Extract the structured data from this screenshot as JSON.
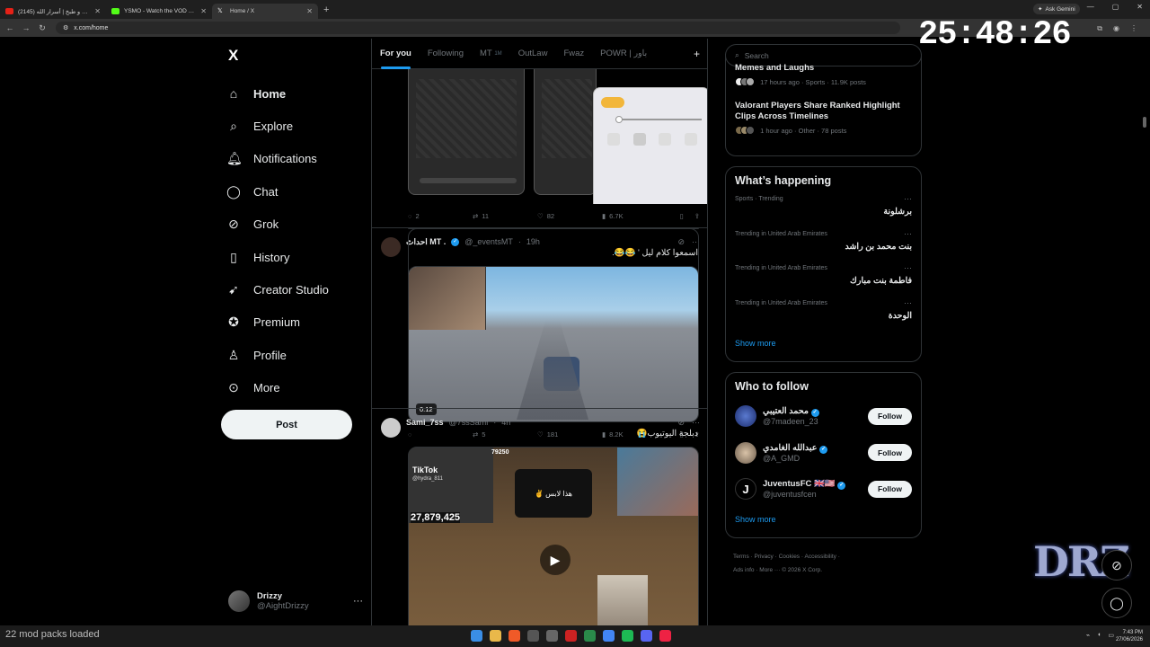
{
  "browser": {
    "tabs": [
      {
        "label": "سوالف و طبخ | أسرار الله (2145)",
        "icon_color": "#e62117",
        "icon": "youtube-icon"
      },
      {
        "label": "YSMO - Watch the VOD on Kick",
        "icon_color": "#53fc18",
        "icon": "kick-icon"
      },
      {
        "label": "Home / X",
        "icon_color": "#ffffff",
        "icon": "x-icon"
      }
    ],
    "new_tab": "+",
    "gemini": "Ask Gemini",
    "url": "x.com/home"
  },
  "overlay": {
    "clock": "25:48:26",
    "logo": "DRZ",
    "mod_packs": "22 mod packs loaded"
  },
  "sidebar": {
    "logo": "X",
    "items": [
      {
        "label": "Home",
        "icon": "home-icon",
        "glyph": "⌂"
      },
      {
        "label": "Explore",
        "icon": "search-icon",
        "glyph": "⌕"
      },
      {
        "label": "Notifications",
        "icon": "bell-icon",
        "glyph": "🔔︎"
      },
      {
        "label": "Chat",
        "icon": "chat-icon",
        "glyph": "◯"
      },
      {
        "label": "Grok",
        "icon": "grok-icon",
        "glyph": "⊘"
      },
      {
        "label": "History",
        "icon": "bookmark-icon",
        "glyph": "▯"
      },
      {
        "label": "Creator Studio",
        "icon": "rocket-icon",
        "glyph": "➹"
      },
      {
        "label": "Premium",
        "icon": "premium-icon",
        "glyph": "✪"
      },
      {
        "label": "Profile",
        "icon": "profile-icon",
        "glyph": "♙"
      },
      {
        "label": "More",
        "icon": "more-icon",
        "glyph": "⊙"
      }
    ],
    "post_button": "Post",
    "account": {
      "name": "Drizzy",
      "handle": "@AightDrizzy",
      "more": "···"
    }
  },
  "timeline": {
    "tabs": [
      "For you",
      "Following",
      "MT",
      "OutLaw",
      "Fwaz",
      "POWR | باور"
    ],
    "mt_badge": "1M",
    "posts": [
      {
        "stats": {
          "replies": "2",
          "reposts": "11",
          "likes": "82",
          "views": "6.7K"
        }
      },
      {
        "name": "احداث MT .",
        "handle": "@_eventsMT",
        "time": "19h",
        "text": "اسمعوا كلام ليل ' 😂😂.",
        "duration": "0:12",
        "stats": {
          "replies": "",
          "reposts": "5",
          "likes": "181",
          "views": "8.2K"
        }
      },
      {
        "name": "Sami_7ss",
        "handle": "@7ssSami",
        "time": "4h",
        "text": "دبلجة اليوتيوب😭",
        "media_labels": {
          "tiktok": "TikTok",
          "tiktok_user": "@hydra_811",
          "count": "27,879,425",
          "caption": "هذا لابس",
          "live_count": "79250"
        }
      }
    ]
  },
  "right": {
    "search_placeholder": "Search",
    "news": [
      {
        "title": "Memes and Laughs",
        "meta": "17 hours ago · Sports · 11.9K posts"
      },
      {
        "title": "Valorant Players Share Ranked Highlight Clips Across Timelines",
        "meta": "1 hour ago · Other · 78 posts"
      }
    ],
    "happening": {
      "title": "What’s happening",
      "trends": [
        {
          "meta": "Sports · Trending",
          "name": "برشلونة"
        },
        {
          "meta": "Trending in United Arab Emirates",
          "name": "بنت محمد بن راشد"
        },
        {
          "meta": "Trending in United Arab Emirates",
          "name": "فاطمة بنت مبارك"
        },
        {
          "meta": "Trending in United Arab Emirates",
          "name": "الوحدة"
        }
      ],
      "show_more": "Show more"
    },
    "who_to_follow": {
      "title": "Who to follow",
      "users": [
        {
          "name": "محمد العتيبي",
          "handle": "@7madeen_23",
          "button": "Follow"
        },
        {
          "name": "عبدالله الغامدي",
          "handle": "@A_GMD",
          "button": "Follow"
        },
        {
          "name": "JuventusFC 🇬🇧🇺🇸",
          "handle": "@juventusfcen",
          "button": "Follow"
        }
      ],
      "show_more": "Show more"
    },
    "footer": [
      "Terms",
      "Privacy",
      "Cookies",
      "Accessibility",
      "Ads info",
      "More ···",
      "© 2026 X Corp."
    ]
  },
  "system": {
    "time": "7:43 PM",
    "date": "27/06/2026"
  }
}
